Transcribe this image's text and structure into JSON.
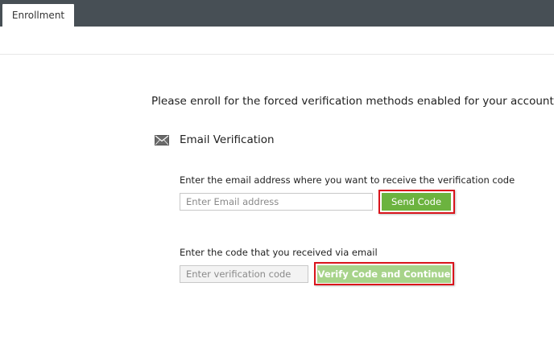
{
  "header": {
    "tabs": [
      {
        "label": "Enrollment",
        "active": true
      }
    ]
  },
  "main": {
    "intro_text": "Please enroll for the forced verification methods enabled for your account.",
    "method": {
      "icon": "envelope-icon",
      "title": "Email Verification"
    },
    "email_step": {
      "label": "Enter the email address where you want to receive the verification code",
      "input_value": "",
      "input_placeholder": "Enter Email address",
      "button_label": "Send Code"
    },
    "code_step": {
      "label": "Enter the code that you received via email",
      "input_value": "",
      "input_placeholder": "Enter verification code",
      "button_label": "Verify Code and Continue"
    }
  },
  "colors": {
    "topbar": "#474f55",
    "send_button": "#6cb33f",
    "verify_button": "#a7d38a",
    "highlight_border": "#d9141b"
  }
}
